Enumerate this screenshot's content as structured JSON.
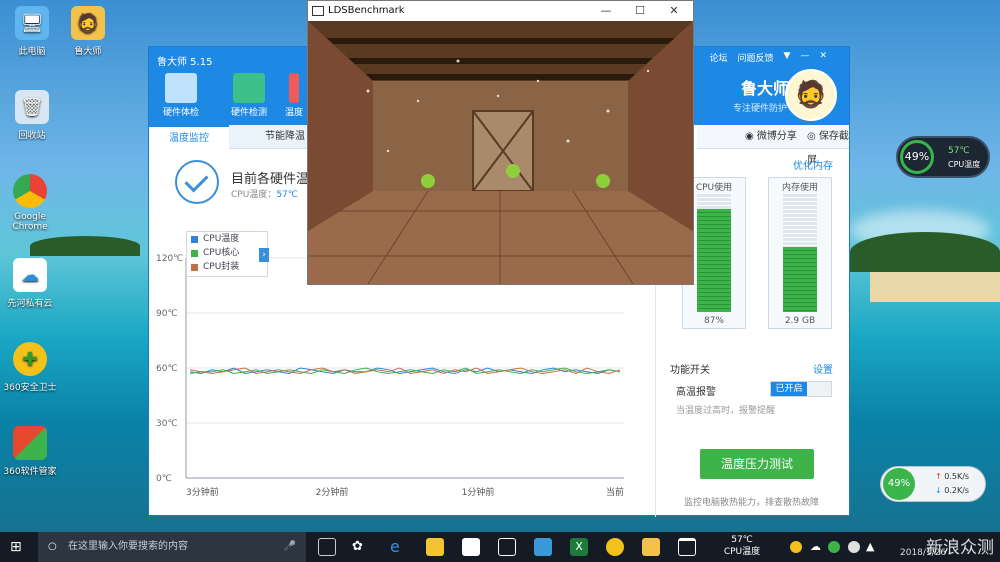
{
  "desktop": {
    "icons": [
      {
        "label": "此电脑"
      },
      {
        "label": "鲁大师"
      },
      {
        "label": "回收站"
      },
      {
        "label": "Google Chrome"
      },
      {
        "label": "先河私有云"
      },
      {
        "label": "360安全卫士"
      },
      {
        "label": "360软件管家"
      }
    ]
  },
  "ludashi": {
    "title": "鲁大师 5.15",
    "top_links": [
      "论坛",
      "问题反馈"
    ],
    "brand": "鲁大师",
    "slogan": "专注硬件防护",
    "tabs": [
      "硬件体检",
      "硬件检测",
      "温度"
    ],
    "subtabs": [
      "温度监控",
      "节能降温"
    ],
    "share": [
      "微博分享",
      "保存截屏"
    ],
    "status_title": "目前各硬件温",
    "status_cpu_label": "CPU温度：",
    "status_cpu_value": "57℃",
    "right_panel": {
      "usage_title": "占用",
      "optimize": "优化内存",
      "cpu_label": "CPU使用",
      "cpu_value": "87%",
      "cpu_pct": 87,
      "mem_label": "内存使用",
      "mem_value": "2.9 GB",
      "mem_pct": 55,
      "feature_title": "功能开关",
      "settings": "设置",
      "alarm_label": "高温报警",
      "alarm_state": "已开启",
      "alarm_hint": "当温度过高时，报警提醒",
      "test_button": "温度压力测试",
      "footer": "监控电脑散热能力，排查散热故障"
    }
  },
  "chart_data": {
    "type": "line",
    "ylabels": [
      "120℃",
      "90℃",
      "60℃",
      "30℃",
      "0℃"
    ],
    "xlabels": [
      "3分钟前",
      "2分钟前",
      "1分钟前",
      "当前"
    ],
    "ylim": [
      0,
      120
    ],
    "series": [
      {
        "name": "CPU温度",
        "color": "#2f80d8",
        "values": [
          58,
          57,
          59,
          58,
          60,
          57,
          58,
          59,
          58,
          57,
          60,
          59,
          58,
          57,
          59,
          58,
          58,
          60,
          59,
          57,
          58,
          59,
          60,
          58,
          57,
          59,
          58,
          60,
          58,
          59,
          58,
          57,
          59,
          60,
          58,
          59,
          58,
          57,
          59,
          58
        ]
      },
      {
        "name": "CPU核心",
        "color": "#3db34a",
        "values": [
          57,
          58,
          58,
          59,
          57,
          58,
          59,
          57,
          58,
          59,
          58,
          57,
          59,
          58,
          57,
          59,
          60,
          58,
          57,
          58,
          59,
          58,
          57,
          59,
          58,
          60,
          57,
          58,
          59,
          58,
          57,
          59,
          58,
          59,
          60,
          58,
          57,
          58,
          59,
          58
        ]
      },
      {
        "name": "CPU封装",
        "color": "#c0714a",
        "values": [
          59,
          58,
          57,
          58,
          59,
          60,
          57,
          58,
          59,
          58,
          57,
          59,
          60,
          58,
          59,
          57,
          58,
          59,
          58,
          60,
          57,
          58,
          59,
          57,
          59,
          58,
          60,
          57,
          58,
          59,
          60,
          58,
          57,
          58,
          59,
          57,
          60,
          58,
          57,
          59
        ]
      }
    ]
  },
  "bench": {
    "title": "LDSBenchmark"
  },
  "taskbar": {
    "search_placeholder": "在这里输入你要搜索的内容",
    "temp_value": "57℃",
    "temp_label": "CPU温度",
    "date": "2018/1/26"
  },
  "float_temp": {
    "pct": "49%",
    "temp": "57℃",
    "label": "CPU温度"
  },
  "float_net": {
    "pct": "49%",
    "up": "0.5K/s",
    "down": "0.2K/s"
  },
  "watermark": "新浪众测"
}
